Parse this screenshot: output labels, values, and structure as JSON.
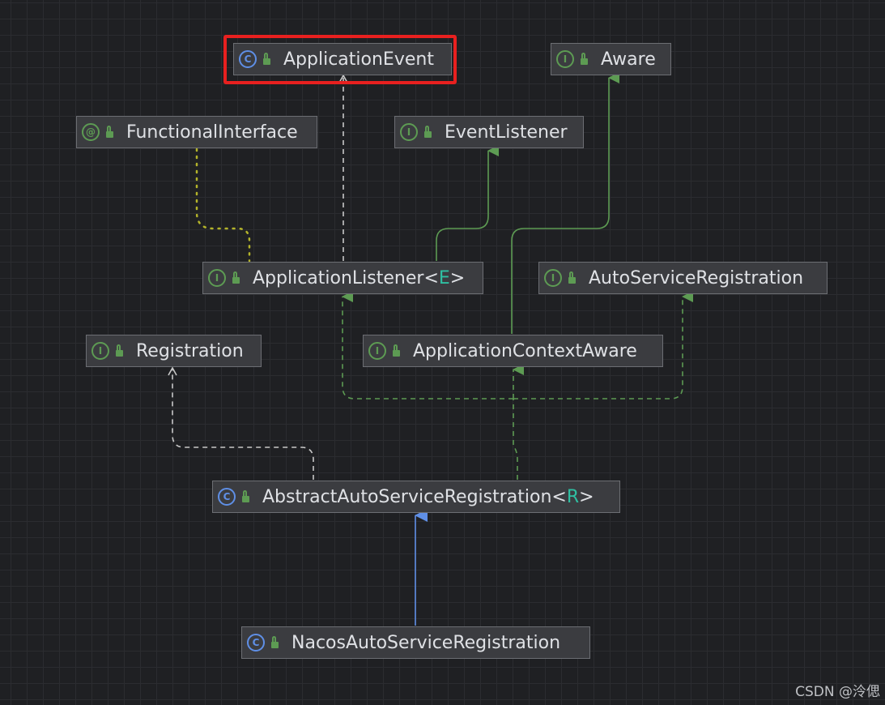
{
  "diagram": {
    "nodes": [
      {
        "id": "application-event",
        "kind": "C",
        "type": "class",
        "name": "ApplicationEvent",
        "type_param": ""
      },
      {
        "id": "aware",
        "kind": "I",
        "type": "interface",
        "name": "Aware",
        "type_param": ""
      },
      {
        "id": "functional-interface",
        "kind": "@",
        "type": "annotation",
        "name": "FunctionalInterface",
        "type_param": ""
      },
      {
        "id": "event-listener",
        "kind": "I",
        "type": "interface",
        "name": "EventListener",
        "type_param": ""
      },
      {
        "id": "application-listener",
        "kind": "I",
        "type": "interface",
        "name": "ApplicationListener",
        "type_param": "E"
      },
      {
        "id": "auto-service-registration",
        "kind": "I",
        "type": "interface",
        "name": "AutoServiceRegistration",
        "type_param": ""
      },
      {
        "id": "registration",
        "kind": "I",
        "type": "interface",
        "name": "Registration",
        "type_param": ""
      },
      {
        "id": "application-context-aware",
        "kind": "I",
        "type": "interface",
        "name": "ApplicationContextAware",
        "type_param": ""
      },
      {
        "id": "abstract-auto-service-registration",
        "kind": "C",
        "type": "class",
        "name": "AbstractAutoServiceRegistration",
        "type_param": "R"
      },
      {
        "id": "nacos-auto-service-registration",
        "kind": "C",
        "type": "class",
        "name": "NacosAutoServiceRegistration",
        "type_param": ""
      }
    ],
    "edges": [
      {
        "from": "application-listener",
        "to": "application-event",
        "relation": "dependency"
      },
      {
        "from": "application-listener",
        "to": "functional-interface",
        "relation": "annotation"
      },
      {
        "from": "application-listener",
        "to": "event-listener",
        "relation": "extends"
      },
      {
        "from": "application-context-aware",
        "to": "aware",
        "relation": "extends"
      },
      {
        "from": "abstract-auto-service-registration",
        "to": "registration",
        "relation": "dependency"
      },
      {
        "from": "abstract-auto-service-registration",
        "to": "application-listener",
        "relation": "implements"
      },
      {
        "from": "abstract-auto-service-registration",
        "to": "auto-service-registration",
        "relation": "implements"
      },
      {
        "from": "abstract-auto-service-registration",
        "to": "application-context-aware",
        "relation": "implements"
      },
      {
        "from": "nacos-auto-service-registration",
        "to": "abstract-auto-service-registration",
        "relation": "extends"
      }
    ],
    "highlighted_node": "application-event"
  },
  "colors": {
    "background": "#1f2023",
    "node_fill": "#3b3c40",
    "extends_line": "#5d9b53",
    "dependency_line": "#c8c8c8",
    "annotation_line": "#b3b32a",
    "class_extends_line": "#5f8fe6",
    "highlight": "#e8201f"
  },
  "watermark": "CSDN @泠偲"
}
